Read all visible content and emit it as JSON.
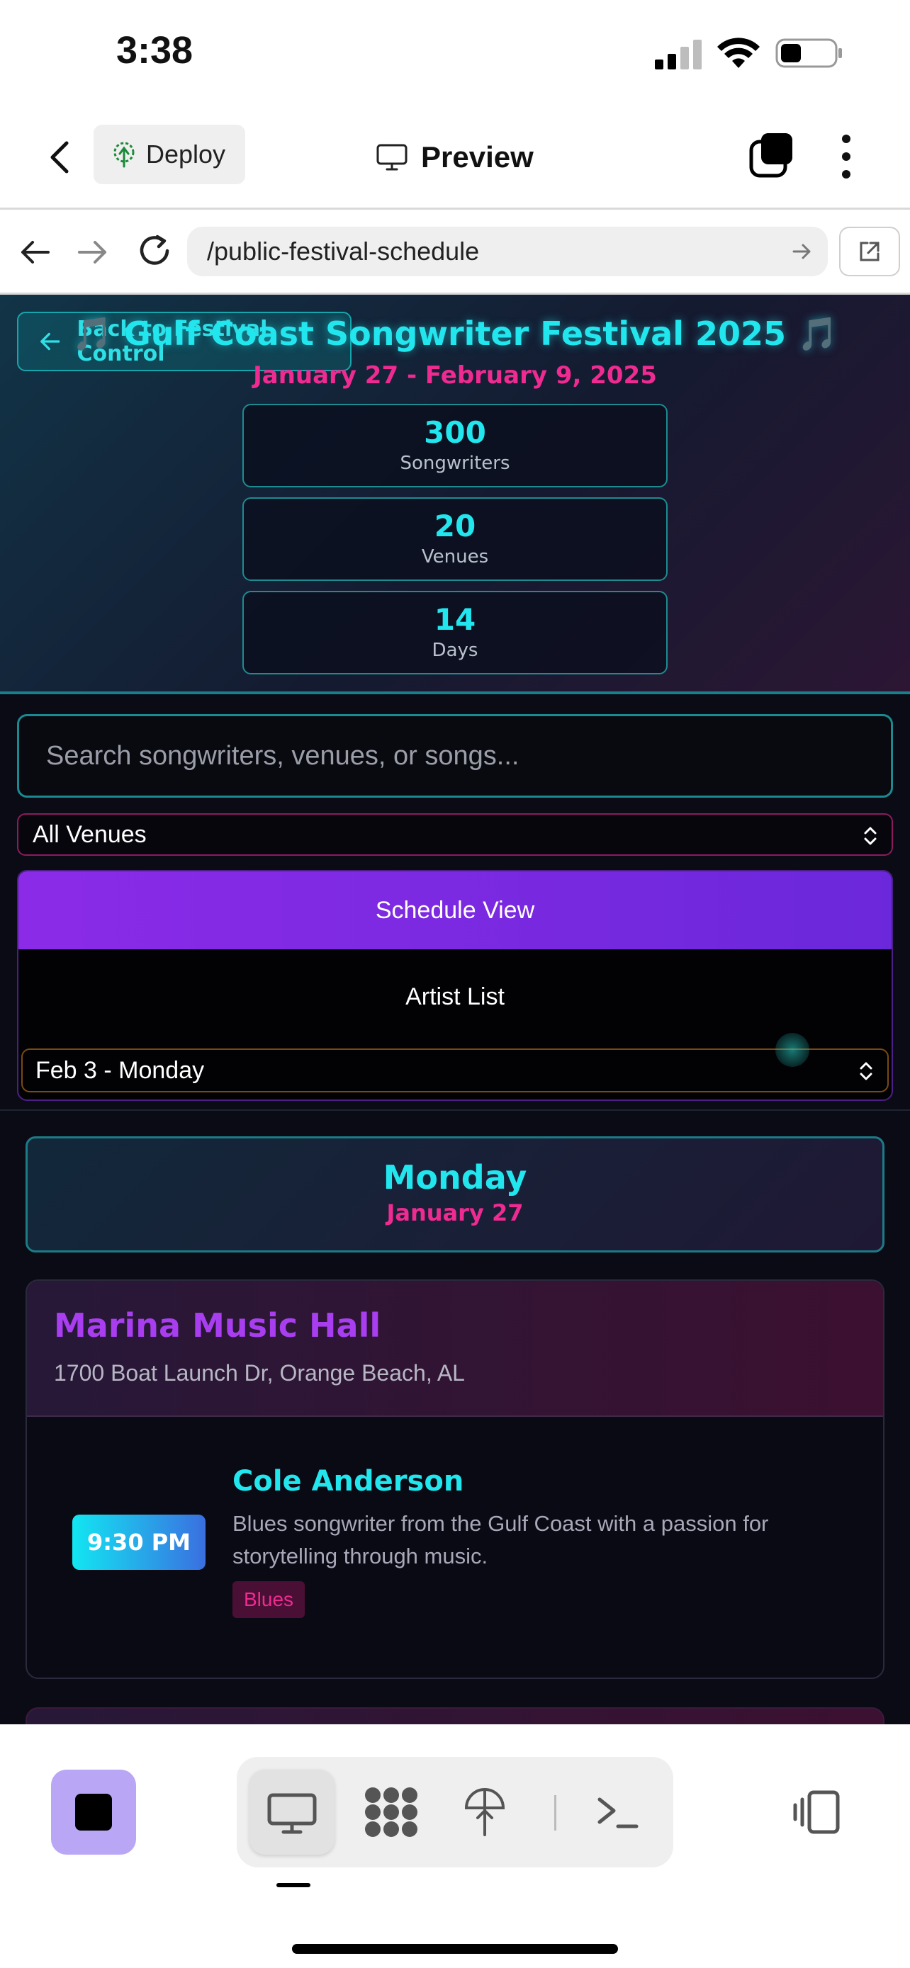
{
  "status_bar": {
    "time": "3:38"
  },
  "app_header": {
    "deploy_label": "Deploy",
    "preview_label": "Preview"
  },
  "url_bar": {
    "url": "/public-festival-schedule"
  },
  "hero": {
    "back_label": "Back to Festival Control",
    "title": "🎵 Gulf Coast Songwriter Festival 2025 🎵",
    "dates": "January 27 - February 9, 2025",
    "stats": [
      {
        "value": "300",
        "label": "Songwriters"
      },
      {
        "value": "20",
        "label": "Venues"
      },
      {
        "value": "14",
        "label": "Days"
      }
    ]
  },
  "filters": {
    "search_placeholder": "Search songwriters, venues, or songs...",
    "venue_select": "All Venues",
    "view_tabs": [
      "Schedule View",
      "Artist List"
    ],
    "day_select": "Feb 3 - Monday"
  },
  "schedule": {
    "day_name": "Monday",
    "day_date": "January 27",
    "venue": {
      "name": "Marina Music Hall",
      "address": "1700 Boat Launch Dr, Orange Beach, AL",
      "performance": {
        "time": "9:30 PM",
        "artist": "Cole Anderson",
        "description": "Blues songwriter from the Gulf Coast with a passion for storytelling through music.",
        "genre": "Blues"
      }
    }
  },
  "colors": {
    "accent_cyan": "#22e6ee",
    "accent_pink": "#ef2a91",
    "accent_purple": "#8b2be8"
  }
}
